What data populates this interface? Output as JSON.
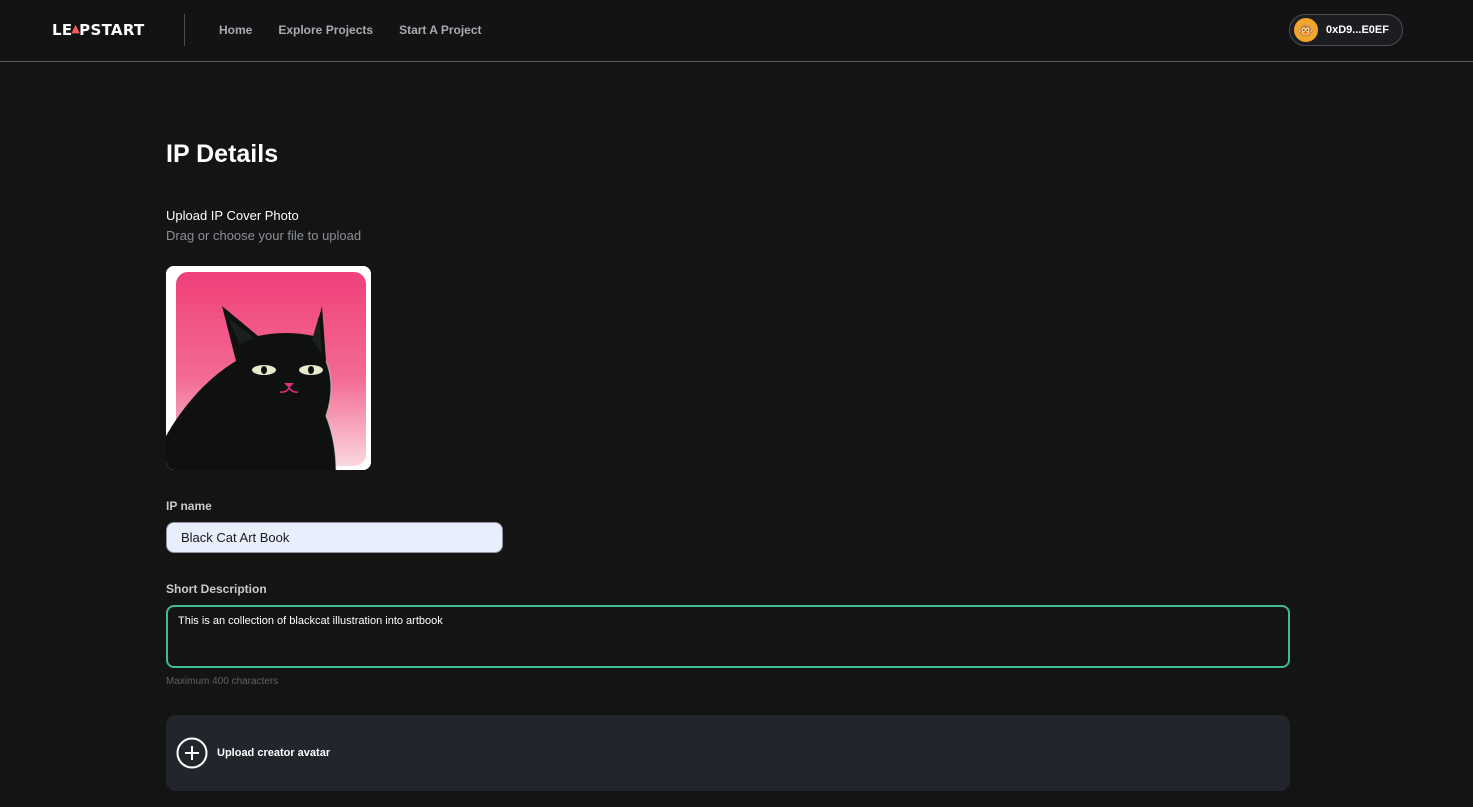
{
  "header": {
    "logo_prefix": "LE",
    "logo_accent": "▲",
    "logo_suffix": "PSTART",
    "nav": [
      {
        "label": "Home"
      },
      {
        "label": "Explore Projects"
      },
      {
        "label": "Start A Project"
      }
    ],
    "wallet": {
      "avatar_glyph": "🐵",
      "address": "0xD9...E0EF"
    }
  },
  "main": {
    "title": "IP Details",
    "cover": {
      "label": "Upload IP Cover Photo",
      "hint": "Drag or choose your file to upload"
    },
    "ip_name": {
      "label": "IP name",
      "value": "Black Cat Art Book"
    },
    "description": {
      "label": "Short Description",
      "value": "This is an collection of blackcat illustration into artbook",
      "hint": "Maximum 400 characters"
    },
    "avatar_upload": {
      "label": "Upload creator avatar"
    }
  },
  "colors": {
    "background": "#141414",
    "accent_green": "#3fbd8c",
    "cover_pink": "#f0407a"
  }
}
